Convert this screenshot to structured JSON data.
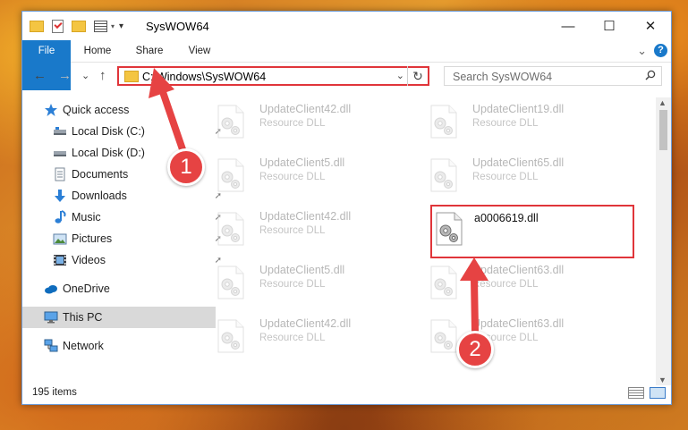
{
  "window": {
    "title": "SysWOW64",
    "controls": {
      "minimize": "—",
      "maximize": "☐",
      "close": "✕"
    }
  },
  "ribbon": {
    "tabs": [
      "File",
      "Home",
      "Share",
      "View"
    ],
    "expand_glyph": "⌄",
    "help_glyph": "?"
  },
  "nav": {
    "back": "←",
    "forward": "→",
    "recent": "⌄",
    "up": "↑",
    "address": "C:\\Windows\\SysWOW64",
    "address_dropdown": "⌄",
    "refresh": "↻",
    "search_placeholder": "Search SysWOW64"
  },
  "sidebar": {
    "items": [
      {
        "label": "Quick access",
        "icon": "star-icon",
        "pinned": false
      },
      {
        "label": "Local Disk (C:)",
        "icon": "drive-icon",
        "pinned": true
      },
      {
        "label": "Local Disk (D:)",
        "icon": "drive-icon",
        "pinned": false
      },
      {
        "label": "Documents",
        "icon": "documents-icon",
        "pinned": false
      },
      {
        "label": "Downloads",
        "icon": "downloads-icon",
        "pinned": true
      },
      {
        "label": "Music",
        "icon": "music-icon",
        "pinned": true
      },
      {
        "label": "Pictures",
        "icon": "pictures-icon",
        "pinned": true
      },
      {
        "label": "Videos",
        "icon": "videos-icon",
        "pinned": true
      },
      {
        "label": "OneDrive",
        "icon": "onedrive-icon",
        "pinned": false
      },
      {
        "label": "This PC",
        "icon": "this-pc-icon",
        "pinned": false,
        "selected": true
      },
      {
        "label": "Network",
        "icon": "network-icon",
        "pinned": false
      }
    ],
    "pin_glyph": "📌"
  },
  "files": [
    {
      "name": "UpdateClient42.dll",
      "type": "Resource DLL",
      "faded": true
    },
    {
      "name": "UpdateClient19.dll",
      "type": "Resource DLL",
      "faded": true
    },
    {
      "name": "UpdateClient5.dll",
      "type": "Resource DLL",
      "faded": true
    },
    {
      "name": "UpdateClient65.dll",
      "type": "Resource DLL",
      "faded": true
    },
    {
      "name": "UpdateClient42.dll",
      "type": "Resource DLL",
      "faded": true
    },
    {
      "name": "a0006619.dll",
      "type": "",
      "faded": false,
      "highlighted": true
    },
    {
      "name": "UpdateClient5.dll",
      "type": "Resource DLL",
      "faded": true
    },
    {
      "name": "UpdateClient63.dll",
      "type": "Resource DLL",
      "faded": true
    },
    {
      "name": "UpdateClient42.dll",
      "type": "Resource DLL",
      "faded": true
    },
    {
      "name": "UpdateClient63.dll",
      "type": "Resource DLL",
      "faded": true
    }
  ],
  "status": {
    "item_count": "195 items"
  },
  "annotations": {
    "step1": "1",
    "step2": "2",
    "accent_color": "#e64343"
  },
  "colors": {
    "file_tab": "#1979ca",
    "highlight_border": "#e0353a",
    "selected_nav": "#d9d9d9"
  }
}
